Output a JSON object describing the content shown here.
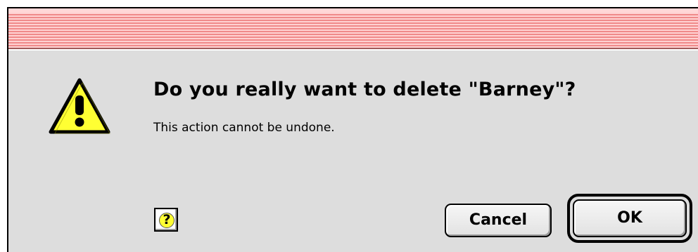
{
  "alert": {
    "headline": "Do you really want to delete \"Barney\"?",
    "message": "This action cannot be undone."
  },
  "buttons": {
    "help_glyph": "?",
    "cancel": "Cancel",
    "ok": "OK"
  },
  "icons": {
    "warning": "warning-triangle-icon",
    "help": "help-balloon-icon"
  },
  "colors": {
    "titlebar_stripe": "#f08a8a",
    "titlebar_light": "#ffd2d2",
    "dialog_bg": "#dddddd",
    "warning_fill": "#ffff33",
    "default_button_ring": "#000000"
  }
}
